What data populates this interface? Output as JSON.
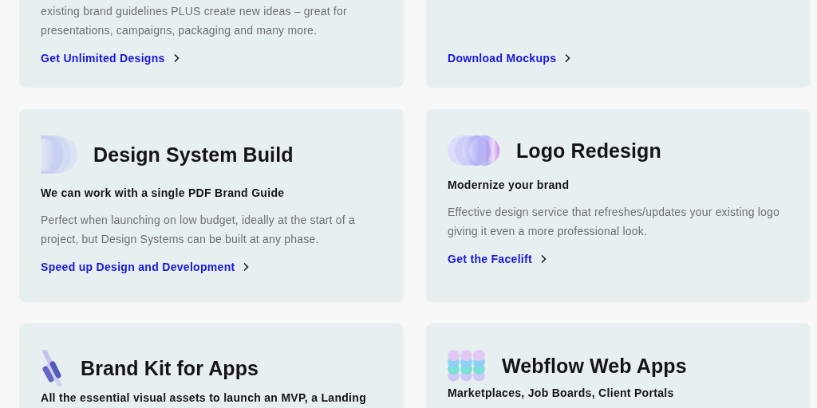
{
  "cards": [
    {
      "description": "existing brand guidelines PLUS create new ideas – great for presentations, campaigns, packaging and many more.",
      "link": "Get Unlimited Designs"
    },
    {
      "link": "Download Mockups"
    },
    {
      "title": "Design System Build",
      "subtitle": "We can work with a single PDF Brand Guide",
      "description": "Perfect when launching on low budget, ideally at the start of a project, but Design Systems can be built at any phase.",
      "link": "Speed up Design and Development"
    },
    {
      "title": "Logo Redesign",
      "subtitle": "Modernize your brand",
      "description": "Effective design service that refreshes/updates your existing logo giving it even a more professional look.",
      "link": "Get the Facelift"
    },
    {
      "title": "Brand Kit for Apps",
      "subtitle": "All the essential visual assets to launch an MVP, a Landing"
    },
    {
      "title": "Webflow Web Apps",
      "subtitle": "Marketplaces, Job Boards, Client Portals"
    }
  ]
}
